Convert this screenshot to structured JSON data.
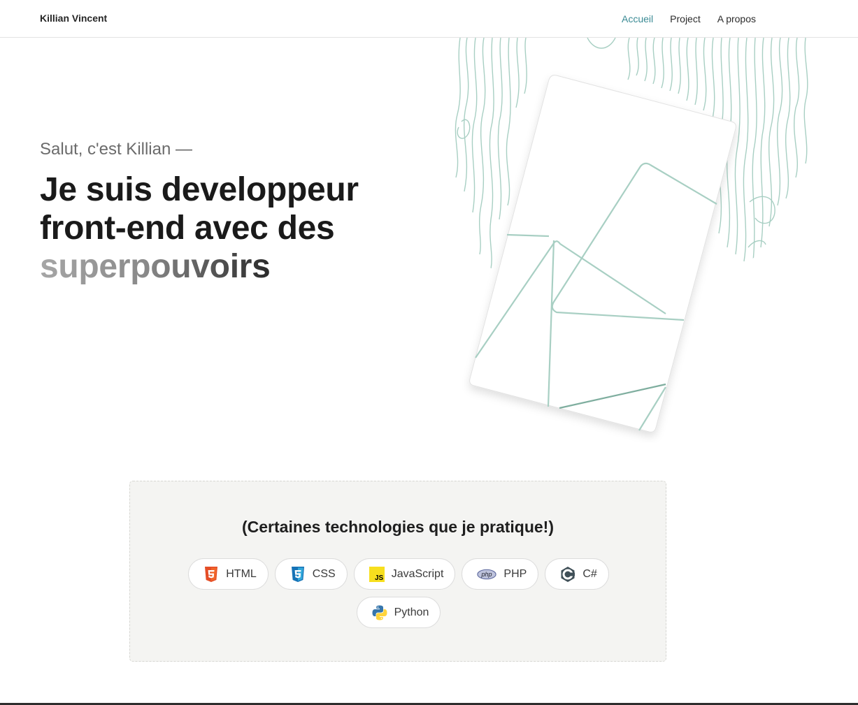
{
  "header": {
    "brand": "Killian Vincent",
    "nav": [
      {
        "label": "Accueil",
        "active": true
      },
      {
        "label": "Project",
        "active": false
      },
      {
        "label": "A propos",
        "active": false
      }
    ]
  },
  "hero": {
    "greeting": "Salut, c'est Killian —",
    "title_line1": "Je suis developpeur",
    "title_line2": "front-end avec des",
    "title_accent": "superpouvoirs"
  },
  "technologies": {
    "title": "(Certaines technologies que je pratique!)",
    "items": [
      {
        "label": "HTML",
        "icon": "html5-icon"
      },
      {
        "label": "CSS",
        "icon": "css3-icon"
      },
      {
        "label": "JavaScript",
        "icon": "javascript-icon"
      },
      {
        "label": "PHP",
        "icon": "php-icon"
      },
      {
        "label": "C#",
        "icon": "csharp-icon"
      },
      {
        "label": "Python",
        "icon": "python-icon"
      }
    ]
  },
  "colors": {
    "accent": "#3a8a94",
    "line_art": "#a8cfc3",
    "tech_background": "#f4f4f2"
  }
}
